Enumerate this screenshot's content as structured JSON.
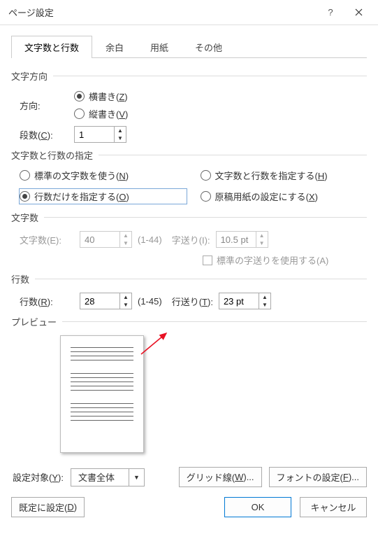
{
  "title": "ページ設定",
  "tabs": [
    "文字数と行数",
    "余白",
    "用紙",
    "その他"
  ],
  "active_tab": 0,
  "direction": {
    "group_label": "文字方向",
    "label": "方向:",
    "options": [
      {
        "text": "横書き(",
        "accel": "Z",
        "suffix": ")",
        "checked": true
      },
      {
        "text": "縦書き(",
        "accel": "V",
        "suffix": ")",
        "checked": false
      }
    ],
    "columns_label": "段数(",
    "columns_accel": "C",
    "columns_suffix": "):",
    "columns_value": "1"
  },
  "spec": {
    "group_label": "文字数と行数の指定",
    "options": [
      {
        "text": "標準の文字数を使う(",
        "accel": "N",
        "suffix": ")",
        "checked": false
      },
      {
        "text": "文字数と行数を指定する(",
        "accel": "H",
        "suffix": ")",
        "checked": false
      },
      {
        "text": "行数だけを指定する(",
        "accel": "O",
        "suffix": ")",
        "checked": true,
        "highlight": true
      },
      {
        "text": "原稿用紙の設定にする(",
        "accel": "X",
        "suffix": ")",
        "checked": false
      }
    ]
  },
  "chars": {
    "group_label": "文字数",
    "count_label": "文字数(E):",
    "count_value": "40",
    "count_range": "(1-44)",
    "pitch_label": "字送り(I):",
    "pitch_value": "10.5 pt",
    "default_pitch_label": "標準の字送りを使用する(A)"
  },
  "lines": {
    "group_label": "行数",
    "count_label": "行数(",
    "count_accel": "R",
    "count_suffix": "):",
    "count_value": "28",
    "count_range": "(1-45)",
    "pitch_label": "行送り(",
    "pitch_accel": "T",
    "pitch_suffix": "):",
    "pitch_value": "23 pt"
  },
  "preview_label": "プレビュー",
  "apply": {
    "label": "設定対象(",
    "accel": "Y",
    "suffix": "):",
    "value": "文書全体"
  },
  "buttons": {
    "grid": {
      "text": "グリッド線(",
      "accel": "W",
      "suffix": ")..."
    },
    "font": {
      "text": "フォントの設定(",
      "accel": "F",
      "suffix": ")..."
    },
    "default": {
      "text": "既定に設定(",
      "accel": "D",
      "suffix": ")"
    },
    "ok": "OK",
    "cancel": "キャンセル"
  }
}
